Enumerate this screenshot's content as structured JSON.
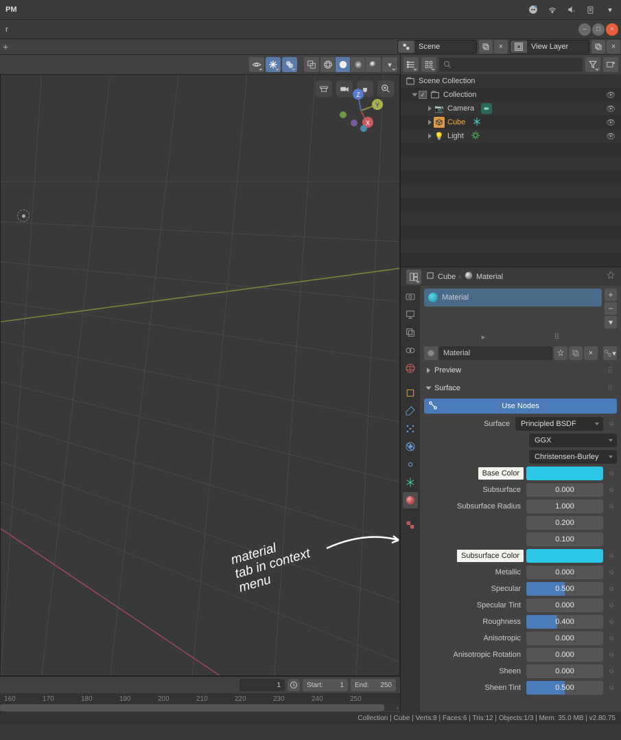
{
  "os": {
    "left": "PM"
  },
  "window": {
    "title": "r"
  },
  "header": {
    "add": "+",
    "scene_label": "Scene",
    "viewlayer_label": "View Layer"
  },
  "outliner": {
    "root": "Scene Collection",
    "collection": "Collection",
    "items": [
      {
        "name": "Camera"
      },
      {
        "name": "Cube"
      },
      {
        "name": "Light"
      }
    ]
  },
  "properties": {
    "crumb_obj": "Cube",
    "crumb_mat": "Material",
    "material_slot": "Material",
    "material_name": "Material",
    "preview": "Preview",
    "surface": "Surface",
    "use_nodes": "Use Nodes",
    "surface_label": "Surface",
    "surface_value": "Principled BSDF",
    "distribution": "GGX",
    "sss_method": "Christensen-Burley",
    "rows": [
      {
        "label": "Base Color",
        "type": "color",
        "boxed": true
      },
      {
        "label": "Subsurface",
        "type": "num",
        "value": "0.000",
        "fill": 0
      },
      {
        "label": "Subsurface Radius",
        "type": "num3",
        "values": [
          "1.000",
          "0.200",
          "0.100"
        ]
      },
      {
        "label": "Subsurface Color",
        "type": "color",
        "boxed": true
      },
      {
        "label": "Metallic",
        "type": "num",
        "value": "0.000",
        "fill": 0
      },
      {
        "label": "Specular",
        "type": "num",
        "value": "0.500",
        "fill": 50
      },
      {
        "label": "Specular Tint",
        "type": "num",
        "value": "0.000",
        "fill": 0
      },
      {
        "label": "Roughness",
        "type": "num",
        "value": "0.400",
        "fill": 40
      },
      {
        "label": "Anisotropic",
        "type": "num",
        "value": "0.000",
        "fill": 0
      },
      {
        "label": "Anisotropic Rotation",
        "type": "num",
        "value": "0.000",
        "fill": 0
      },
      {
        "label": "Sheen",
        "type": "num",
        "value": "0.000",
        "fill": 0
      },
      {
        "label": "Sheen Tint",
        "type": "num",
        "value": "0.500",
        "fill": 50
      }
    ]
  },
  "timeline": {
    "current": "1",
    "start_label": "Start:",
    "start": "1",
    "end_label": "End:",
    "end": "250",
    "ticks": [
      "160",
      "170",
      "180",
      "190",
      "200",
      "210",
      "220",
      "230",
      "240",
      "250"
    ]
  },
  "status": "Collection | Cube | Verts:8 | Faces:6 | Tris:12 | Objects:1/3 | Mem: 35.0 MB | v2.80.75",
  "annotation": {
    "l1": "material",
    "l2": "tab in context",
    "l3": "menu"
  }
}
